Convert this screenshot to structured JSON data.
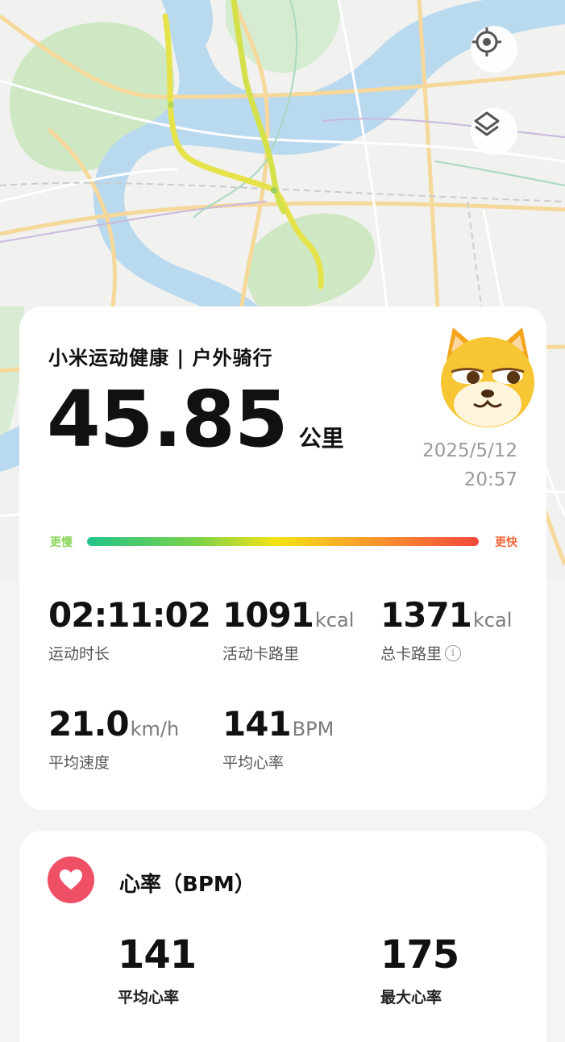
{
  "map": {
    "locate_icon": "locate-icon",
    "layers_icon": "layers-icon"
  },
  "summary": {
    "app_title": "小米运动健康 | 户外骑行",
    "distance": "45.85",
    "distance_unit": "公里",
    "date": "2025/5/12",
    "time": "20:57",
    "speed_slow_label": "更慢",
    "speed_fast_label": "更快",
    "stats": [
      {
        "value": "02:11:02",
        "unit": "",
        "label": "运动时长"
      },
      {
        "value": "1091",
        "unit": "kcal",
        "label": "活动卡路里"
      },
      {
        "value": "1371",
        "unit": "kcal",
        "label": "总卡路里"
      },
      {
        "value": "21.0",
        "unit": "km/h",
        "label": "平均速度"
      },
      {
        "value": "141",
        "unit": "BPM",
        "label": "平均心率"
      }
    ],
    "info_icon": "i"
  },
  "heart_rate": {
    "title": "心率（BPM）",
    "avg_value": "141",
    "avg_label": "平均心率",
    "max_value": "175",
    "max_label": "最大心率"
  },
  "colors": {
    "accent_heart": "#ef5066",
    "speed_slow": "#8bd45a",
    "speed_fast": "#f0683a",
    "route": "#e6e24a"
  }
}
